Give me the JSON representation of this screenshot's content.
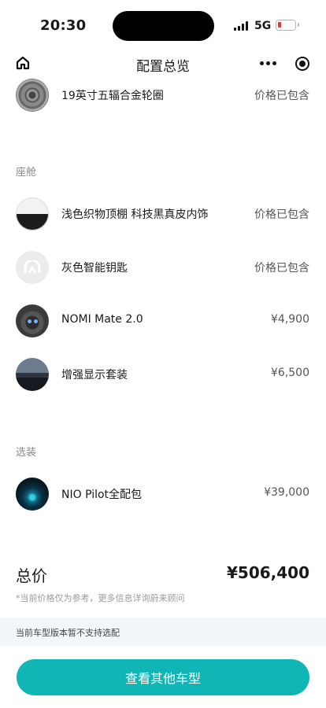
{
  "status_bar": {
    "time": "20:30",
    "network": "5G"
  },
  "nav": {
    "title": "配置总览"
  },
  "rows_top": [
    {
      "label": "19英寸五辐合金轮圈",
      "price": "价格已包含",
      "thumb": "wheel-thumb"
    }
  ],
  "cabin": {
    "title": "座舱",
    "items": [
      {
        "label": "浅色织物顶棚 科技黑真皮内饰",
        "price": "价格已包含",
        "thumb": "interior-thumb"
      },
      {
        "label": "灰色智能钥匙",
        "price": "价格已包含",
        "thumb": "key-thumb"
      },
      {
        "label": "NOMI Mate 2.0",
        "price": "¥4,900",
        "thumb": "nomi-thumb"
      },
      {
        "label": "增强显示套装",
        "price": "¥6,500",
        "thumb": "hud-thumb"
      }
    ]
  },
  "options": {
    "title": "选装",
    "items": [
      {
        "label": "NIO Pilot全配包",
        "price": "¥39,000",
        "thumb": "pilot-thumb"
      }
    ]
  },
  "total": {
    "label": "总价",
    "value": "¥506,400",
    "disclaimer": "*当前价格仅为参考，更多信息详询蔚来顾问"
  },
  "notice": "当前车型版本暂不支持选配",
  "cta_label": "查看其他车型",
  "colors": {
    "accent": "#10b5b6",
    "notice_bg": "#f1f6fb",
    "battery_low": "#e53935"
  }
}
